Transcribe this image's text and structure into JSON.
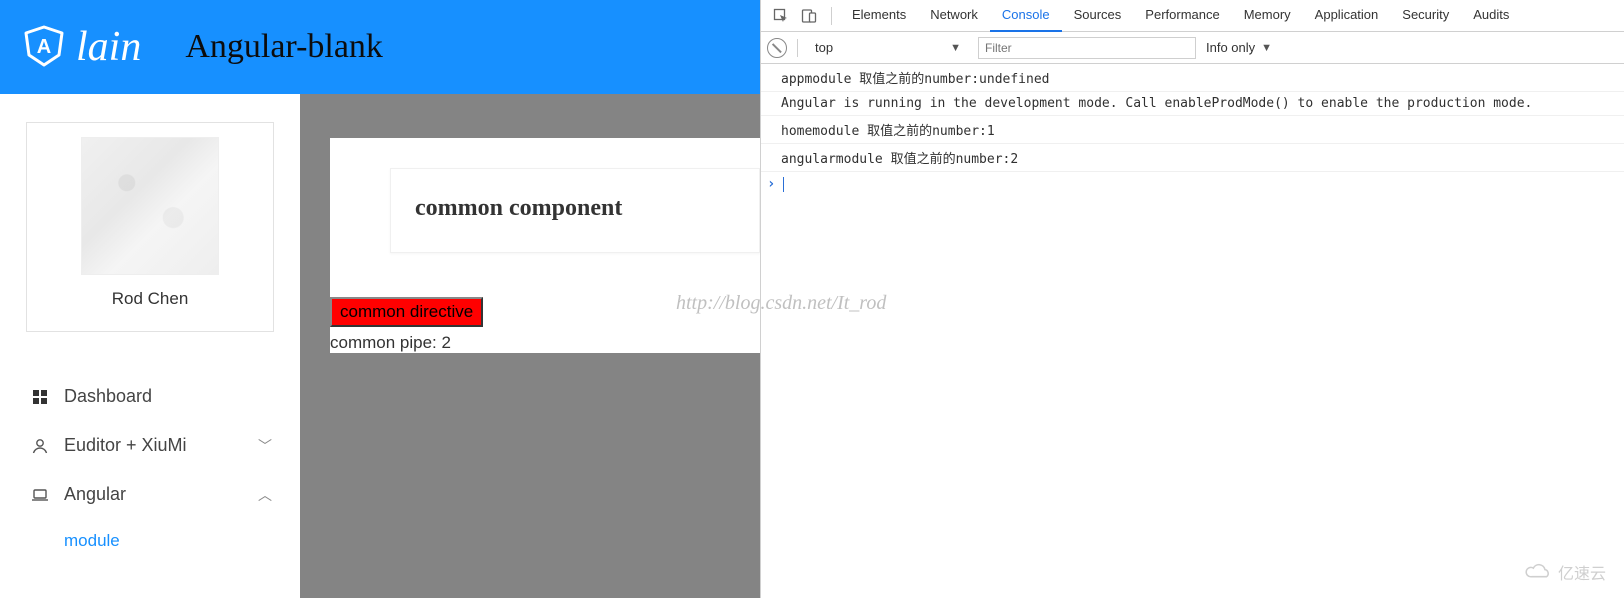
{
  "header": {
    "logo_text": "lain",
    "title": "Angular-blank"
  },
  "profile": {
    "name": "Rod Chen"
  },
  "nav": {
    "dashboard": "Dashboard",
    "euditor": "Euditor + XiuMi",
    "angular": "Angular",
    "module": "module"
  },
  "card": {
    "title": "common component",
    "directive": "common directive",
    "pipe": "common pipe: 2"
  },
  "watermark": "http://blog.csdn.net/It_rod",
  "badge": "亿速云",
  "devtools": {
    "tabs": {
      "elements": "Elements",
      "network": "Network",
      "console": "Console",
      "sources": "Sources",
      "performance": "Performance",
      "memory": "Memory",
      "application": "Application",
      "security": "Security",
      "audits": "Audits"
    },
    "toolbar": {
      "context": "top",
      "filter_placeholder": "Filter",
      "level": "Info only"
    },
    "logs": [
      "appmodule 取值之前的number:undefined",
      "Angular is running in the development mode. Call enableProdMode() to enable the production mode.",
      "homemodule 取值之前的number:1",
      "angularmodule 取值之前的number:2"
    ]
  }
}
